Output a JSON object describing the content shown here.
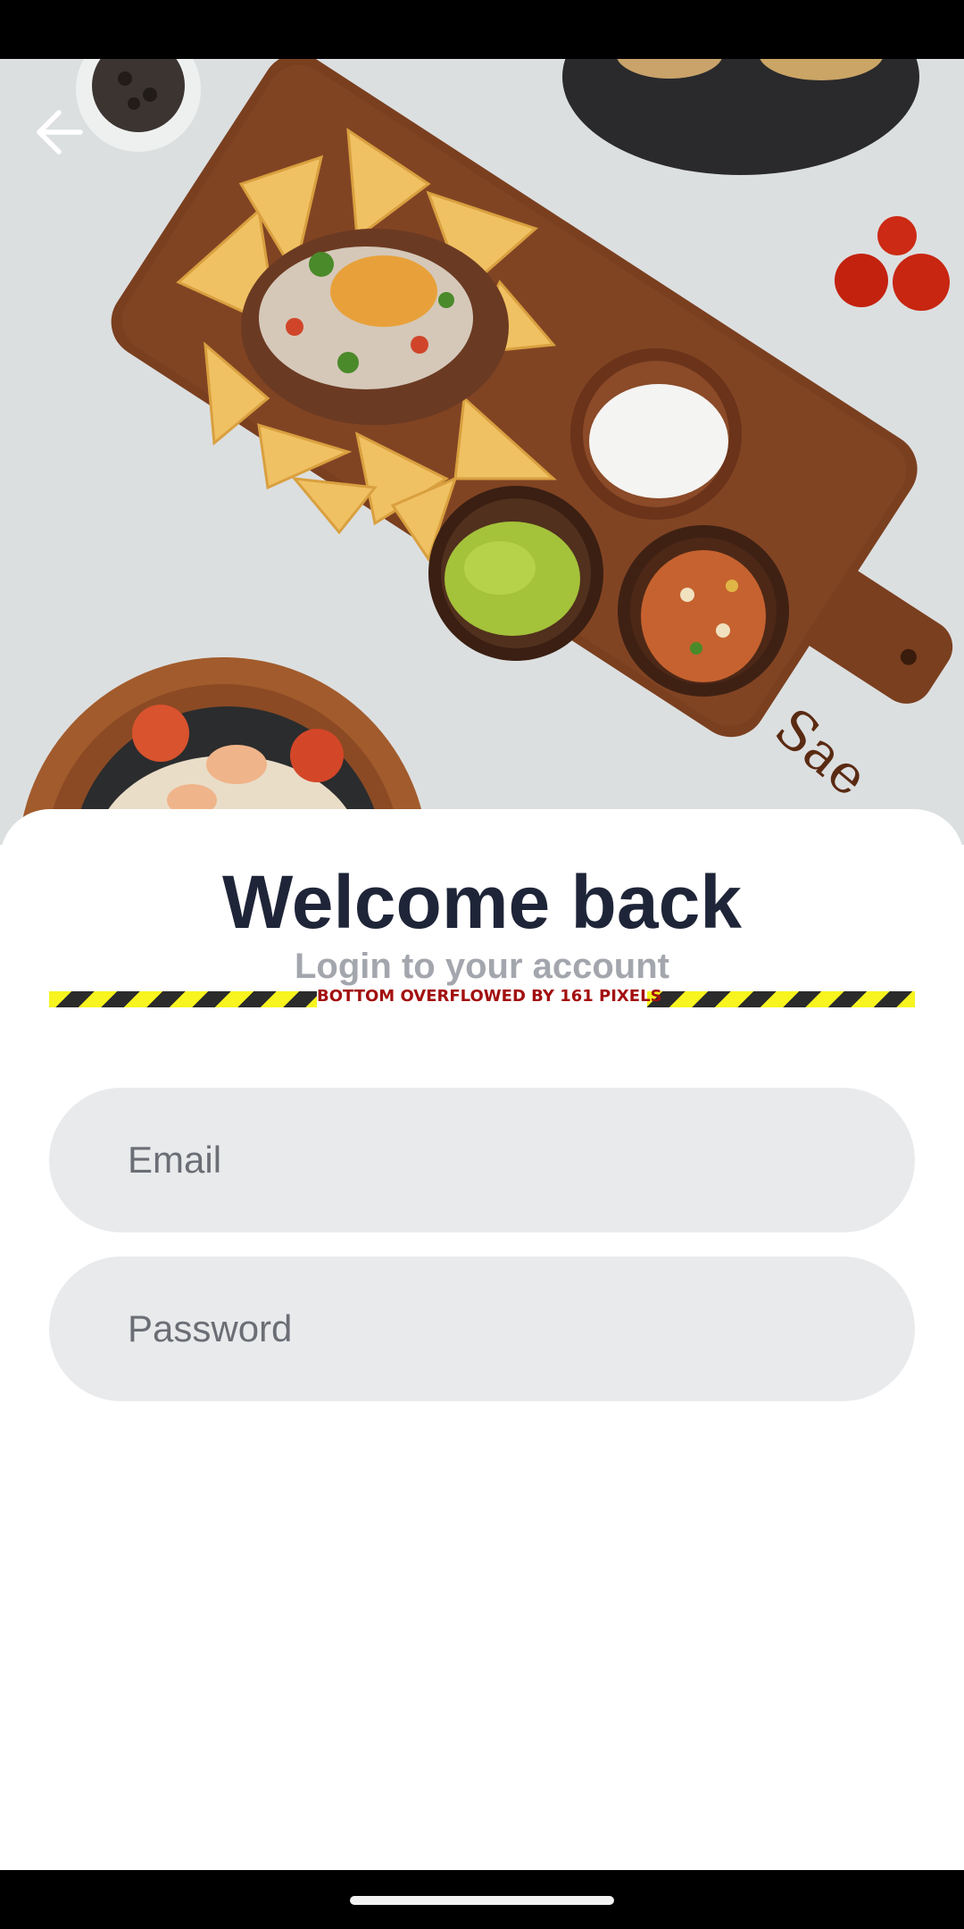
{
  "header": {
    "back_icon": "arrow-left-icon"
  },
  "hero": {
    "description_icon": "food-platter-image",
    "board_engraving": "Sae"
  },
  "login": {
    "title": "Welcome back",
    "subtitle": "Login to your account",
    "overflow_warning": "BOTTOM OVERFLOWED BY 161 PIXELS",
    "email_placeholder": "Email",
    "password_placeholder": "Password"
  },
  "colors": {
    "title": "#1f2538",
    "subtitle": "#a3a6ad",
    "field_background": "#e9eaec",
    "overflow_text": "#a30f0f",
    "stripe_yellow": "#f7f41f",
    "stripe_dark": "#2b2b2b"
  }
}
